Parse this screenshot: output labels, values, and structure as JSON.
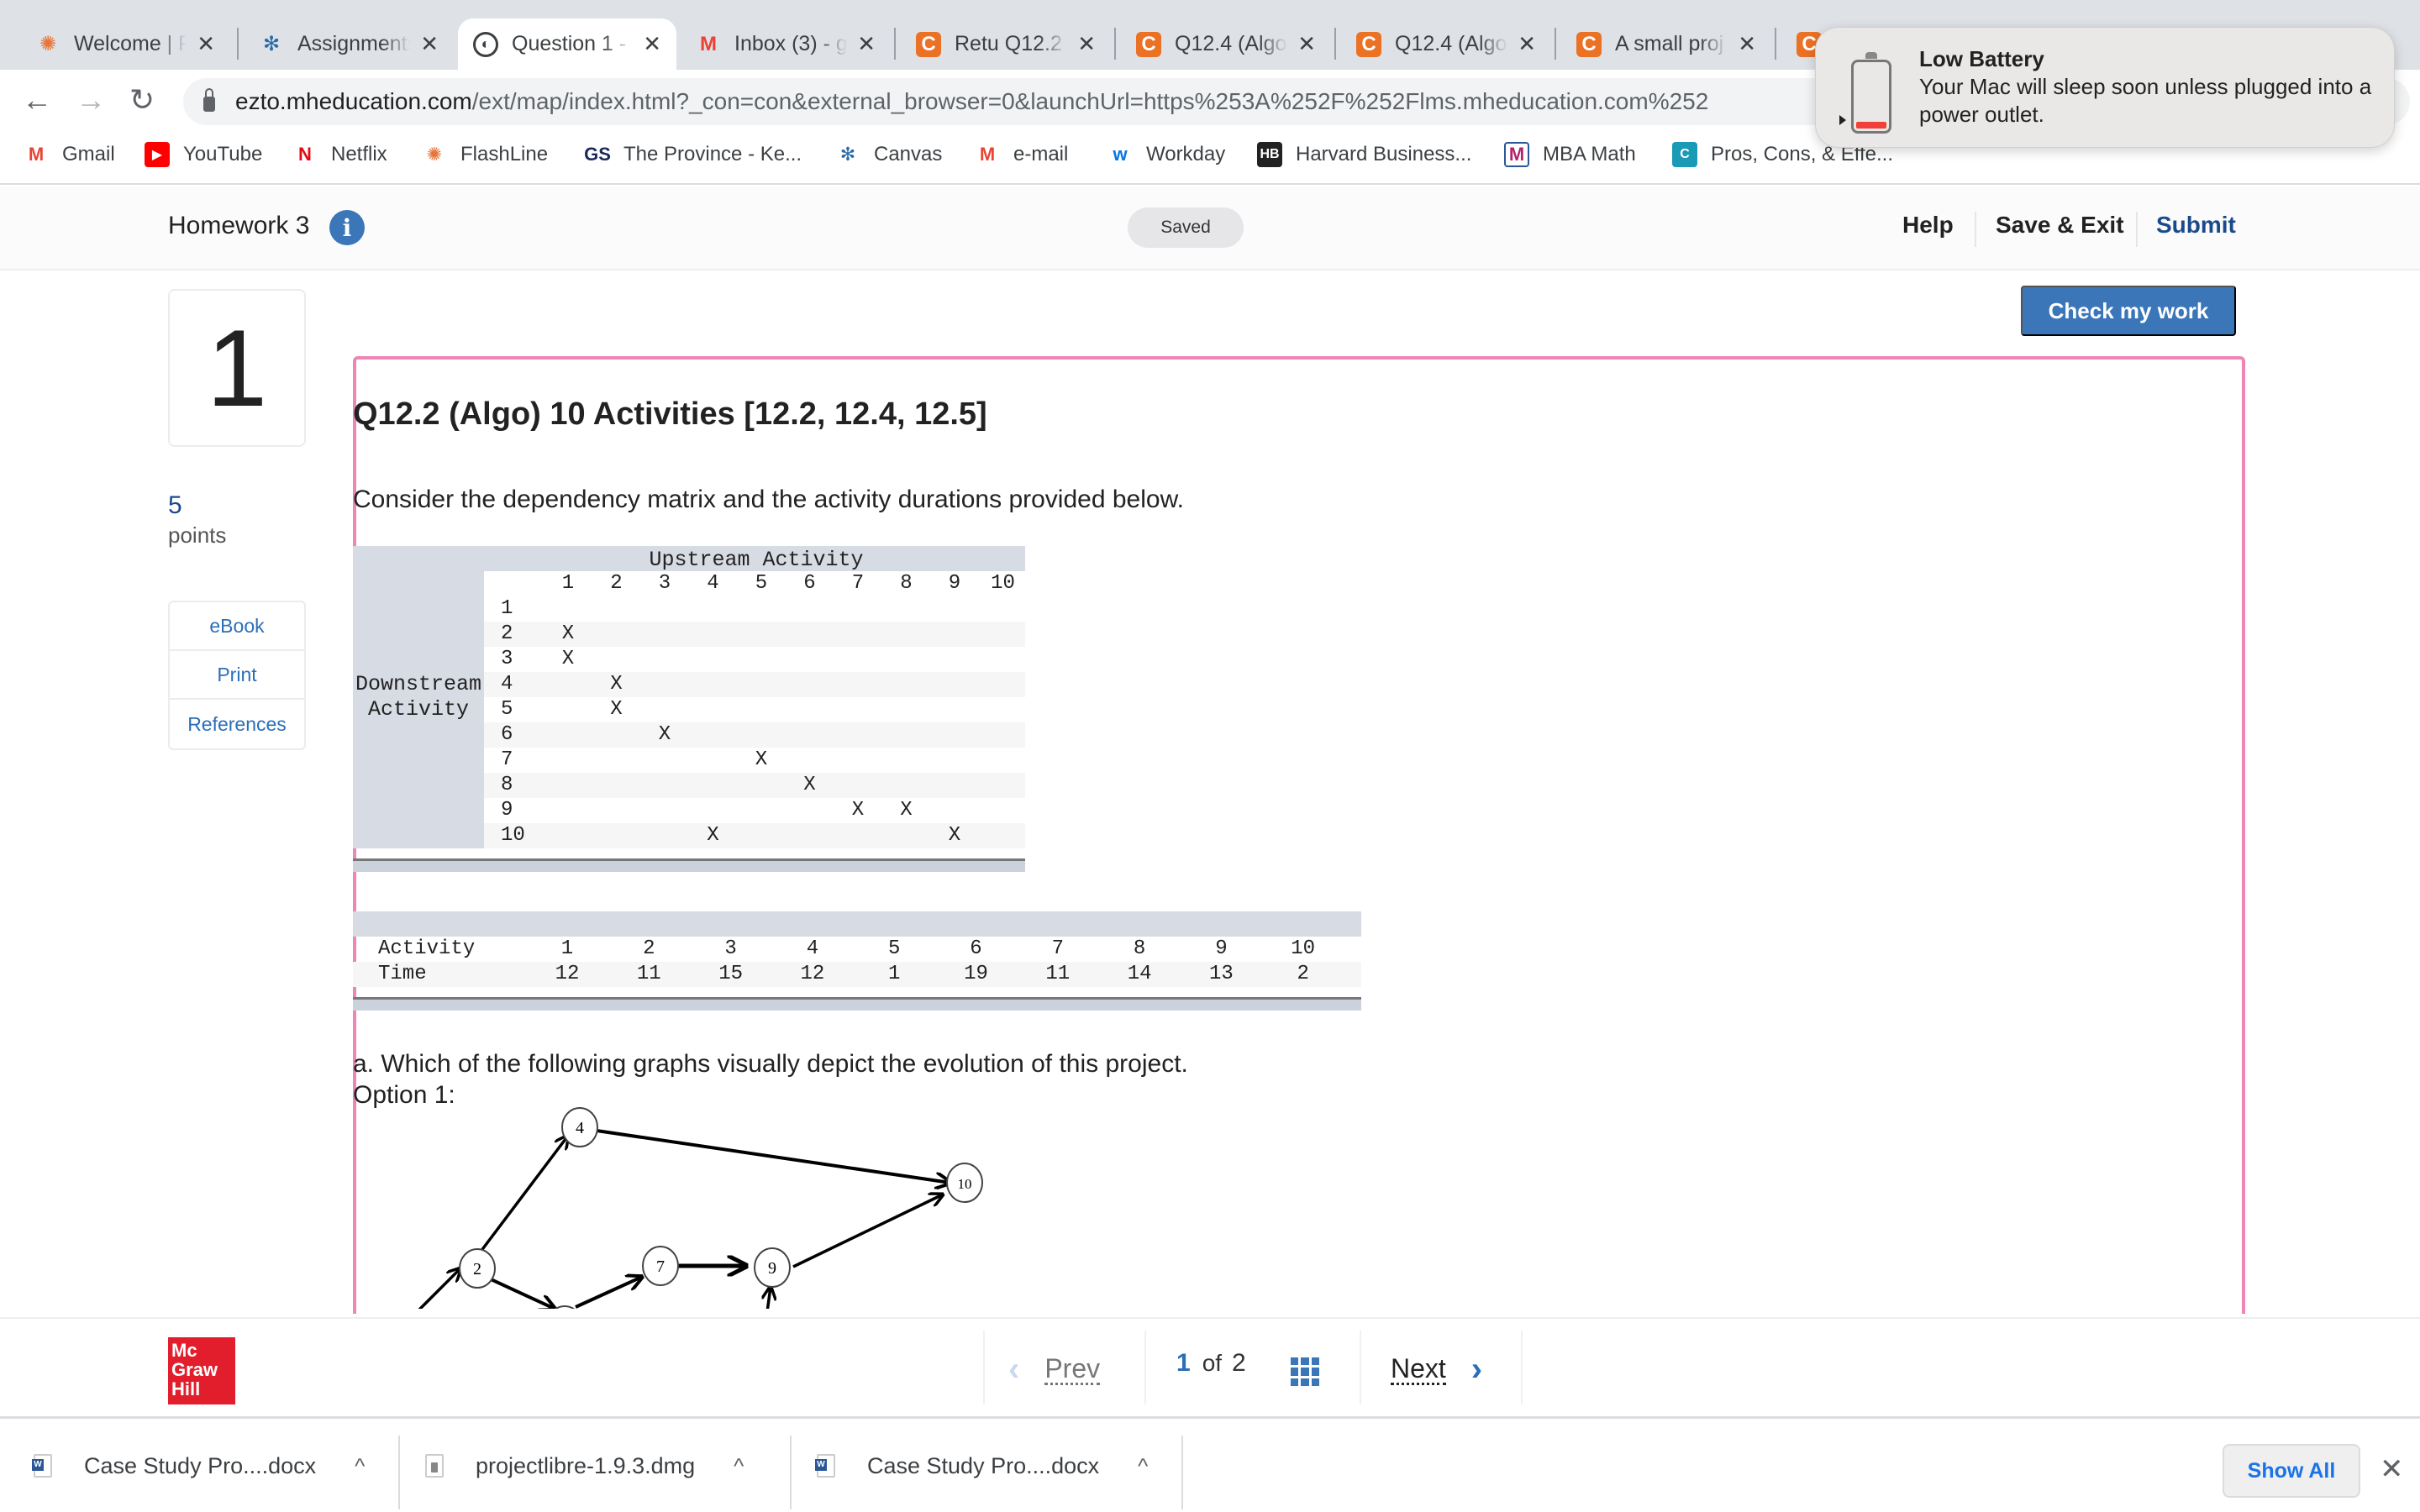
{
  "browser": {
    "tabs": [
      {
        "title": "Welcome | FlashLine",
        "icon": "flashline-icon",
        "color": "#e8763a",
        "active": false
      },
      {
        "title": "Assignments",
        "icon": "canvas-icon",
        "color": "#2b6ba8",
        "active": false
      },
      {
        "title": "Question 1 -",
        "icon": "globe-icon",
        "color": "#3c4043",
        "active": true
      },
      {
        "title": "Inbox (3) - g",
        "icon": "gmail-icon",
        "color": "#ea4335",
        "active": false
      },
      {
        "title": "Retu Q12.2",
        "icon": "chegg-icon",
        "color": "#eb7125",
        "active": false
      },
      {
        "title": "Q12.4 (Algo",
        "icon": "chegg-icon",
        "color": "#eb7125",
        "active": false
      },
      {
        "title": "Q12.4 (Algo",
        "icon": "chegg-icon",
        "color": "#eb7125",
        "active": false
      },
      {
        "title": "A small proj",
        "icon": "chegg-icon",
        "color": "#eb7125",
        "active": false
      },
      {
        "title": "",
        "icon": "chegg-icon",
        "color": "#eb7125",
        "active": false
      }
    ],
    "url_host": "ezto.mheducation.com",
    "url_path": "/ext/map/index.html?_con=con&external_browser=0&launchUrl=https%253A%252F%252Flms.mheducation.com%252",
    "bookmarks": [
      {
        "label": "Gmail",
        "icon": "gmail-icon",
        "glyph": "M",
        "color": "#ea4335"
      },
      {
        "label": "YouTube",
        "icon": "youtube-icon",
        "glyph": "▶",
        "color": "#ff0000"
      },
      {
        "label": "Netflix",
        "icon": "netflix-icon",
        "glyph": "N",
        "color": "#e50914"
      },
      {
        "label": "FlashLine",
        "icon": "flashline-icon",
        "glyph": "✺",
        "color": "#e8763a"
      },
      {
        "label": "The Province - Ke...",
        "icon": "gs-icon",
        "glyph": "GS",
        "color": "#1a2a5a"
      },
      {
        "label": "Canvas",
        "icon": "canvas-icon",
        "glyph": "✻",
        "color": "#2b6ba8"
      },
      {
        "label": "e-mail",
        "icon": "gmail-icon",
        "glyph": "M",
        "color": "#ea4335"
      },
      {
        "label": "Workday",
        "icon": "workday-icon",
        "glyph": "w",
        "color": "#0875e1"
      },
      {
        "label": "Harvard Business...",
        "icon": "hbr-icon",
        "glyph": "HB",
        "color": "#222222"
      },
      {
        "label": "MBA Math",
        "icon": "mba-math-icon",
        "glyph": "M",
        "color": "#b0256b"
      },
      {
        "label": "Pros, Cons, & Effe...",
        "icon": "chegg-icon",
        "glyph": "C",
        "color": "#1a9bb5"
      }
    ]
  },
  "notification": {
    "title": "Low Battery",
    "body": "Your Mac will sleep soon unless plugged into a power outlet.",
    "battery_level_fraction": 0.1
  },
  "header": {
    "title": "Homework 3",
    "info_glyph": "i",
    "status": "Saved",
    "help": "Help",
    "save_exit": "Save & Exit",
    "submit": "Submit"
  },
  "check_my_work": "Check my work",
  "question": {
    "number": "1",
    "points_value": "5",
    "points_label": "points",
    "tools": [
      "eBook",
      "Print",
      "References"
    ],
    "title": "Q12.2 (Algo) 10 Activities [12.2, 12.4, 12.5]",
    "intro": "Consider the dependency matrix and the activity durations provided below.",
    "matrix": {
      "upstream_label": "Upstream Activity",
      "downstream_label_1": "Downstream",
      "downstream_label_2": "Activity",
      "columns": [
        "1",
        "2",
        "3",
        "4",
        "5",
        "6",
        "7",
        "8",
        "9",
        "10"
      ],
      "rows": [
        {
          "label": "1",
          "marks": []
        },
        {
          "label": "2",
          "marks": [
            1
          ]
        },
        {
          "label": "3",
          "marks": [
            1
          ]
        },
        {
          "label": "4",
          "marks": [
            2
          ]
        },
        {
          "label": "5",
          "marks": [
            2
          ]
        },
        {
          "label": "6",
          "marks": [
            3
          ]
        },
        {
          "label": "7",
          "marks": [
            5
          ]
        },
        {
          "label": "8",
          "marks": [
            6
          ]
        },
        {
          "label": "9",
          "marks": [
            7,
            8
          ]
        },
        {
          "label": "10",
          "marks": [
            4,
            9
          ]
        }
      ],
      "mark": "X"
    },
    "durations": {
      "activity_label": "Activity",
      "time_label": "Time",
      "activities": [
        "1",
        "2",
        "3",
        "4",
        "5",
        "6",
        "7",
        "8",
        "9",
        "10"
      ],
      "times": [
        "12",
        "11",
        "15",
        "12",
        "1",
        "19",
        "11",
        "14",
        "13",
        "2"
      ]
    },
    "part_a": "a. Which of the following graphs visually depict the evolution of this project.",
    "option_label": "Option 1:",
    "graph_nodes": [
      "2",
      "4",
      "7",
      "9",
      "10"
    ]
  },
  "pagination": {
    "prev": "Prev",
    "current": "1",
    "of": "of",
    "total": "2",
    "next": "Next"
  },
  "logo": {
    "line1": "Mc",
    "line2": "Graw",
    "line3": "Hill"
  },
  "downloads": {
    "items": [
      {
        "name": "Case Study Pro....docx",
        "type": "word"
      },
      {
        "name": "projectlibre-1.9.3.dmg",
        "type": "dmg"
      },
      {
        "name": "Case Study Pro....docx",
        "type": "word"
      }
    ],
    "show_all": "Show All"
  }
}
